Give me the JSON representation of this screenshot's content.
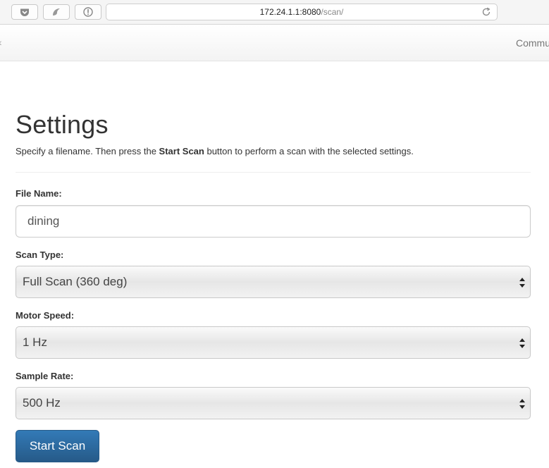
{
  "browser": {
    "url_host": "172.24.1.1:8080",
    "url_path": "/scan/",
    "icons": [
      "pocket-icon",
      "tab-icon",
      "info-icon",
      "reload-icon"
    ]
  },
  "navbar": {
    "link_label": "Commu"
  },
  "page": {
    "title": "Settings",
    "intro_before": "Specify a filename. Then press the ",
    "intro_bold": "Start Scan",
    "intro_after": " button to perform a scan with the selected settings."
  },
  "form": {
    "file_name_label": "File Name:",
    "file_name_value": "dining",
    "scan_type_label": "Scan Type:",
    "scan_type_value": "Full Scan (360 deg)",
    "motor_speed_label": "Motor Speed:",
    "motor_speed_value": "1 Hz",
    "sample_rate_label": "Sample Rate:",
    "sample_rate_value": "500 Hz",
    "submit_label": "Start Scan"
  },
  "colors": {
    "primary": "#337ab7",
    "primary_dark": "#265a88"
  }
}
